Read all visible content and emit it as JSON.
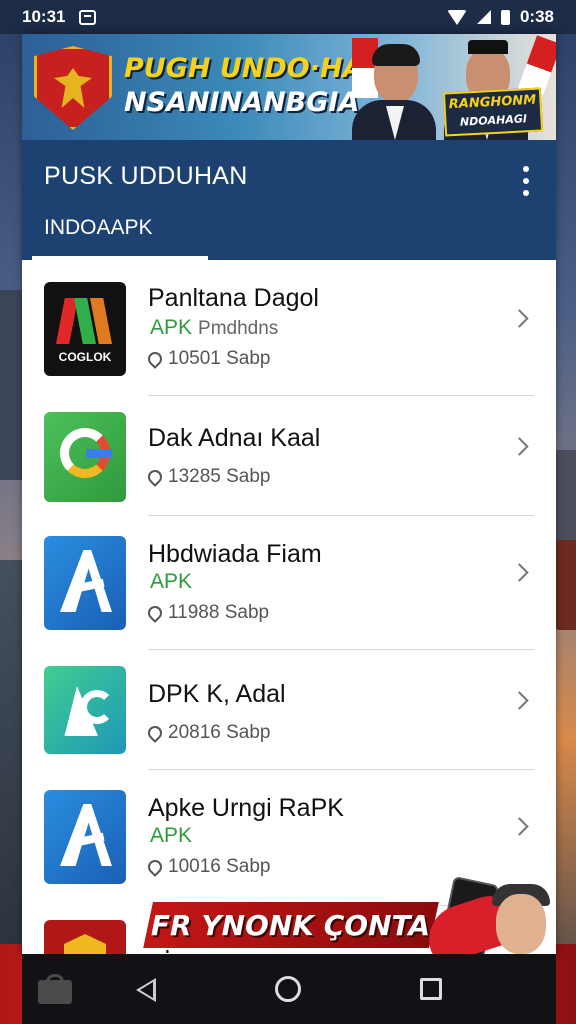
{
  "status_bar": {
    "time": "10:31",
    "right_text": "0:38"
  },
  "banner": {
    "line1": "PUGH UNDO·HAN",
    "line2": "NSANINANBGIA",
    "badge_line1": "RANGHONM",
    "badge_line2": "NDOAHAGI"
  },
  "header": {
    "title": "PUSK UDDUHAN",
    "tab_label": "INDOAAPK"
  },
  "apps": [
    {
      "name": "Panltana Dagol",
      "tag": "APK",
      "tag_extra": "Pmdhdns",
      "size": "10501 Sabp",
      "icon_label": "COGLOK"
    },
    {
      "name": "Dak Adnaı Kaal",
      "tag": "",
      "tag_extra": "",
      "size": "13285 Sabp",
      "icon_label": ""
    },
    {
      "name": "Hbdwiada Fiam",
      "tag": "APK",
      "tag_extra": "",
      "size": "11988 Sabp",
      "icon_label": ""
    },
    {
      "name": "DPK K, Adal",
      "tag": "",
      "tag_extra": "",
      "size": "20816 Sabp",
      "icon_label": ""
    },
    {
      "name": "Apke Urngi RaPK",
      "tag": "APK",
      "tag_extra": "",
      "size": "10016 Sabp",
      "icon_label": ""
    },
    {
      "name": "Ap",
      "tag": "",
      "tag_extra": "",
      "size": "",
      "icon_label": ""
    }
  ],
  "promo": {
    "text": "FR YNONK ÇONTA"
  },
  "colors": {
    "header_bg": "#1d4272",
    "status_bar_bg": "#1c2b46",
    "apk_tag": "#2e9c3a"
  }
}
